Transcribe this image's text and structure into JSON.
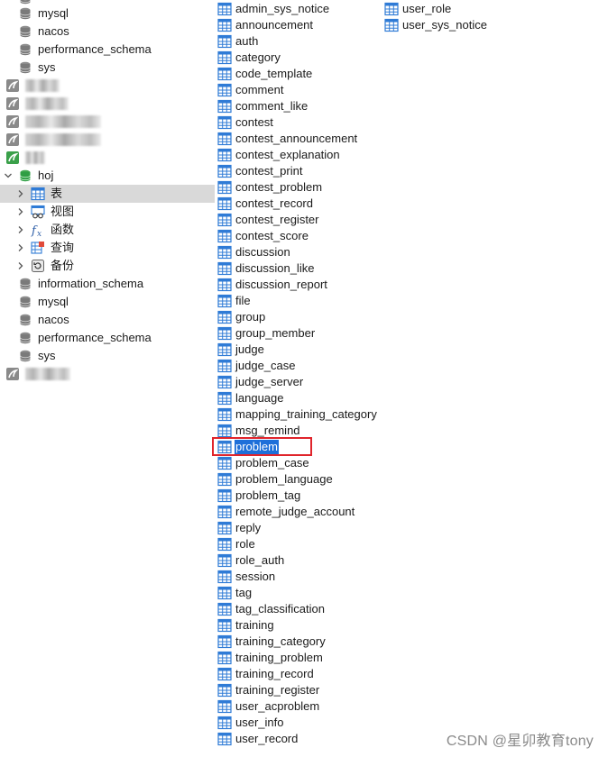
{
  "tree": {
    "top_items": [
      {
        "label": "mysql",
        "icon": "database-icon"
      },
      {
        "label": "nacos",
        "icon": "database-icon"
      },
      {
        "label": "performance_schema",
        "icon": "database-icon"
      },
      {
        "label": "sys",
        "icon": "database-icon"
      }
    ],
    "active_connection": {
      "label": "hoj",
      "icon": "database-icon"
    },
    "folders": [
      {
        "label": "表",
        "icon": "table-folder-icon"
      },
      {
        "label": "视图",
        "icon": "view-folder-icon"
      },
      {
        "label": "函数",
        "icon": "function-folder-icon"
      },
      {
        "label": "查询",
        "icon": "query-folder-icon"
      },
      {
        "label": "备份",
        "icon": "backup-folder-icon"
      }
    ],
    "bottom_items": [
      {
        "label": "information_schema",
        "icon": "database-icon"
      },
      {
        "label": "mysql",
        "icon": "database-icon"
      },
      {
        "label": "nacos",
        "icon": "database-icon"
      },
      {
        "label": "performance_schema",
        "icon": "database-icon"
      },
      {
        "label": "sys",
        "icon": "database-icon"
      }
    ]
  },
  "tables_col1": [
    "admin_sys_notice",
    "announcement",
    "auth",
    "category",
    "code_template",
    "comment",
    "comment_like",
    "contest",
    "contest_announcement",
    "contest_explanation",
    "contest_print",
    "contest_problem",
    "contest_record",
    "contest_register",
    "contest_score",
    "discussion",
    "discussion_like",
    "discussion_report",
    "file",
    "group",
    "group_member",
    "judge",
    "judge_case",
    "judge_server",
    "language",
    "mapping_training_category",
    "msg_remind",
    "problem",
    "problem_case",
    "problem_language",
    "problem_tag",
    "remote_judge_account",
    "reply",
    "role",
    "role_auth",
    "session",
    "tag",
    "tag_classification",
    "training",
    "training_category",
    "training_problem",
    "training_record",
    "training_register",
    "user_acproblem",
    "user_info",
    "user_record"
  ],
  "tables_col2": [
    "user_role",
    "user_sys_notice"
  ],
  "selected_table": "problem",
  "watermark": "CSDN @星卯教育tony",
  "colors": {
    "selection_bg": "#1e6fd9",
    "highlight_border": "#e0242b",
    "tree_selected_bg": "#d9d9d9",
    "table_icon_blue": "#2f7bd6",
    "db_icon_gray": "#7a7a7a",
    "db_icon_green": "#2f9e44"
  }
}
